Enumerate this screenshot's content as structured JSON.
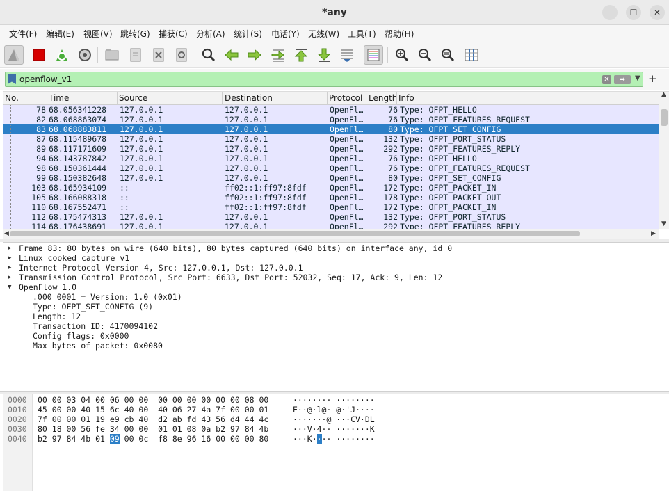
{
  "window": {
    "title": "*any",
    "controls": [
      "–",
      "☐",
      "✕"
    ]
  },
  "menu": [
    "文件(F)",
    "编辑(E)",
    "视图(V)",
    "跳转(G)",
    "捕获(C)",
    "分析(A)",
    "统计(S)",
    "电话(Y)",
    "无线(W)",
    "工具(T)",
    "帮助(H)"
  ],
  "filter": {
    "value": "openflow_v1",
    "plus_label": "+"
  },
  "packet_list": {
    "columns": [
      "No.",
      "Time",
      "Source",
      "Destination",
      "Protocol",
      "Length",
      "Info"
    ],
    "rows": [
      {
        "no": "78",
        "time": "68.056341228",
        "src": "127.0.0.1",
        "dst": "127.0.0.1",
        "proto": "OpenFl…",
        "len": "76",
        "info": "Type: OFPT_HELLO"
      },
      {
        "no": "82",
        "time": "68.068863074",
        "src": "127.0.0.1",
        "dst": "127.0.0.1",
        "proto": "OpenFl…",
        "len": "76",
        "info": "Type: OFPT_FEATURES_REQUEST"
      },
      {
        "no": "83",
        "time": "68.068883811",
        "src": "127.0.0.1",
        "dst": "127.0.0.1",
        "proto": "OpenFl…",
        "len": "80",
        "info": "Type: OFPT_SET_CONFIG",
        "selected": true
      },
      {
        "no": "87",
        "time": "68.115489678",
        "src": "127.0.0.1",
        "dst": "127.0.0.1",
        "proto": "OpenFl…",
        "len": "132",
        "info": "Type: OFPT_PORT_STATUS"
      },
      {
        "no": "89",
        "time": "68.117171609",
        "src": "127.0.0.1",
        "dst": "127.0.0.1",
        "proto": "OpenFl…",
        "len": "292",
        "info": "Type: OFPT_FEATURES_REPLY"
      },
      {
        "no": "94",
        "time": "68.143787842",
        "src": "127.0.0.1",
        "dst": "127.0.0.1",
        "proto": "OpenFl…",
        "len": "76",
        "info": "Type: OFPT_HELLO"
      },
      {
        "no": "98",
        "time": "68.150361444",
        "src": "127.0.0.1",
        "dst": "127.0.0.1",
        "proto": "OpenFl…",
        "len": "76",
        "info": "Type: OFPT_FEATURES_REQUEST"
      },
      {
        "no": "99",
        "time": "68.150382648",
        "src": "127.0.0.1",
        "dst": "127.0.0.1",
        "proto": "OpenFl…",
        "len": "80",
        "info": "Type: OFPT_SET_CONFIG"
      },
      {
        "no": "103",
        "time": "68.165934109",
        "src": "::",
        "dst": "ff02::1:ff97:8fdf",
        "proto": "OpenFl…",
        "len": "172",
        "info": "Type: OFPT_PACKET_IN"
      },
      {
        "no": "105",
        "time": "68.166088318",
        "src": "::",
        "dst": "ff02::1:ff97:8fdf",
        "proto": "OpenFl…",
        "len": "178",
        "info": "Type: OFPT_PACKET_OUT"
      },
      {
        "no": "110",
        "time": "68.167552471",
        "src": "::",
        "dst": "ff02::1:ff97:8fdf",
        "proto": "OpenFl…",
        "len": "172",
        "info": "Type: OFPT_PACKET_IN"
      },
      {
        "no": "112",
        "time": "68.175474313",
        "src": "127.0.0.1",
        "dst": "127.0.0.1",
        "proto": "OpenFl…",
        "len": "132",
        "info": "Type: OFPT_PORT_STATUS"
      },
      {
        "no": "114",
        "time": "68.176438691",
        "src": "127.0.0.1",
        "dst": "127.0.0.1",
        "proto": "OpenFl…",
        "len": "292",
        "info": "Type: OFPT_FEATURES_REPLY"
      }
    ]
  },
  "details": [
    {
      "text": "Frame 83: 80 bytes on wire (640 bits), 80 bytes captured (640 bits) on interface any, id 0",
      "expanded": false,
      "indent": 0
    },
    {
      "text": "Linux cooked capture v1",
      "expanded": false,
      "indent": 0
    },
    {
      "text": "Internet Protocol Version 4, Src: 127.0.0.1, Dst: 127.0.0.1",
      "expanded": false,
      "indent": 0
    },
    {
      "text": "Transmission Control Protocol, Src Port: 6633, Dst Port: 52032, Seq: 17, Ack: 9, Len: 12",
      "expanded": false,
      "indent": 0
    },
    {
      "text": "OpenFlow 1.0",
      "expanded": true,
      "indent": 0
    },
    {
      "text": ".000 0001 = Version: 1.0 (0x01)",
      "indent": 1
    },
    {
      "text": "Type: OFPT_SET_CONFIG (9)",
      "indent": 1
    },
    {
      "text": "Length: 12",
      "indent": 1
    },
    {
      "text": "Transaction ID: 4170094102",
      "indent": 1
    },
    {
      "text": "Config flags: 0x0000",
      "indent": 1
    },
    {
      "text": "Max bytes of packet: 0x0080",
      "indent": 1
    }
  ],
  "bytes": [
    {
      "offset": "0000",
      "hex": "00 00 03 04 00 06 00 00  00 00 00 00 00 00 08 00",
      "ascii": "········ ········"
    },
    {
      "offset": "0010",
      "hex": "45 00 00 40 15 6c 40 00  40 06 27 4a 7f 00 00 01",
      "ascii": "E··@·l@· @·'J····"
    },
    {
      "offset": "0020",
      "hex": "7f 00 00 01 19 e9 cb 40  d2 ab fd 43 56 d4 44 4c",
      "ascii": "·······@ ···CV·DL"
    },
    {
      "offset": "0030",
      "hex": "80 18 00 56 fe 34 00 00  01 01 08 0a b2 97 84 4b",
      "ascii": "···V·4·· ·······K"
    },
    {
      "offset": "0040",
      "hex_pre": "b2 97 84 4b 01 ",
      "hex_hl": "09",
      "hex_post": " 00 0c  f8 8e 96 16 00 00 00 80",
      "ascii_pre": "···K·",
      "ascii_hl": "·",
      "ascii_post": "·· ········"
    }
  ]
}
